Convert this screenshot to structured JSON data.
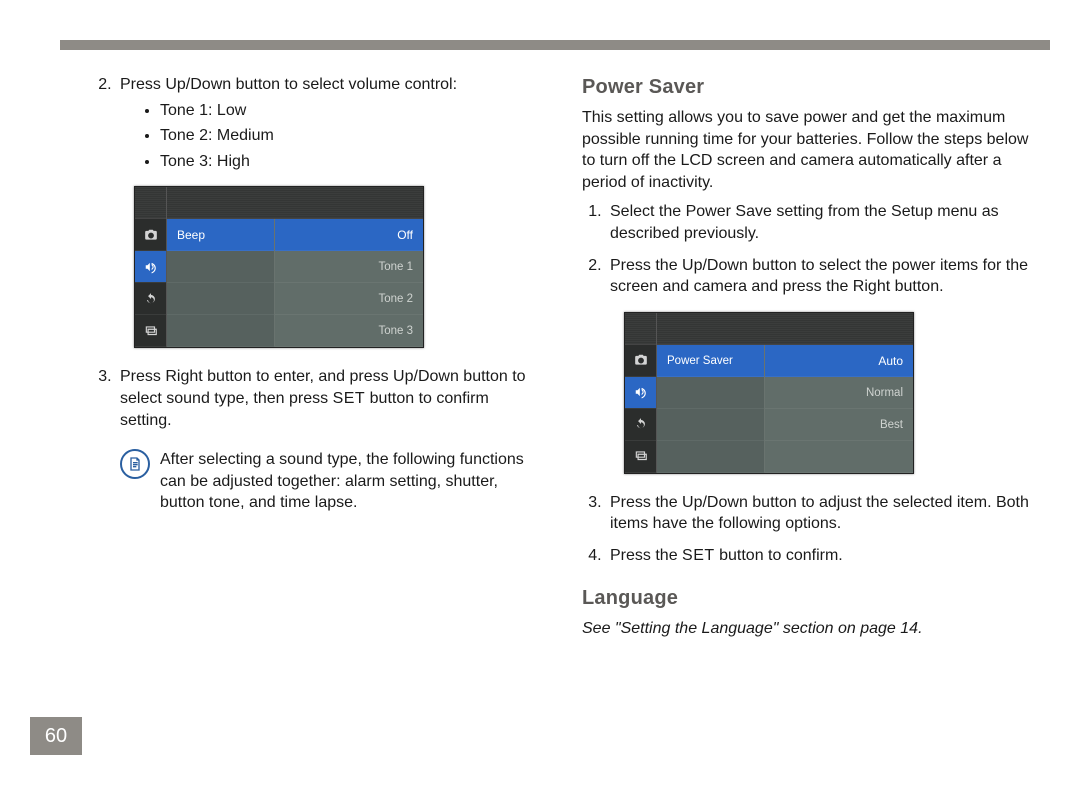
{
  "page_number": "60",
  "left": {
    "step2_intro": "Press Up/Down button to select volume control:",
    "bullets": [
      "Tone 1: Low",
      "Tone 2: Medium",
      "Tone 3: High"
    ],
    "step3_a": "Press Right button to enter, and press Up/Down button to select sound type, then press ",
    "step3_set": "SET",
    "step3_b": " button to confirm setting.",
    "note": "After selecting a sound type, the following functions can be adjusted together: alarm setting, shutter, button tone, and time lapse.",
    "lcd": {
      "selected_label": "Beep",
      "selected_value": "Off",
      "options": [
        "Tone 1",
        "Tone 2",
        "Tone 3"
      ]
    }
  },
  "right": {
    "heading_power": "Power Saver",
    "intro": "This setting allows you to save power and get the maximum possible running time for your batteries. Follow the steps below to turn off the LCD screen and camera automatically after a period of inactivity.",
    "step1": "Select the Power Save setting from the Setup menu as described previously.",
    "step2": "Press the Up/Down button to select the power items for the screen and camera and press the Right button.",
    "step3": "Press the Up/Down button to adjust the selected item. Both items have the following options.",
    "step4_a": "Press the ",
    "step4_set": "SET",
    "step4_b": " button to confirm.",
    "lcd": {
      "selected_label": "Power Saver",
      "selected_value": "Auto",
      "options": [
        "Normal",
        "Best"
      ]
    },
    "heading_lang": "Language",
    "lang_note": "See \"Setting the Language\" section on page 14."
  }
}
